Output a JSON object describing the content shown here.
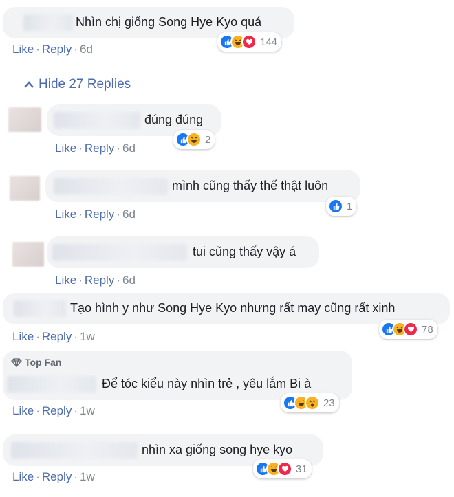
{
  "comments": [
    {
      "text": "Nhìn chị giống Song Hye Kyo quá",
      "like": "Like",
      "reply": "Reply",
      "time": "6d",
      "reaction_count": "144",
      "reactions": [
        "like-icon",
        "haha-icon",
        "love-icon"
      ]
    },
    {
      "text": "đúng đúng",
      "like": "Like",
      "reply": "Reply",
      "time": "6d",
      "reaction_count": "2",
      "reactions": [
        "like-icon",
        "haha-icon"
      ]
    },
    {
      "text": "mình cũng thấy thế thật luôn",
      "like": "Like",
      "reply": "Reply",
      "time": "6d",
      "reaction_count": "1",
      "reactions": [
        "like-icon"
      ]
    },
    {
      "text": "tui cũng thấy vậy á",
      "like": "Like",
      "reply": "Reply",
      "time": "6d"
    },
    {
      "text": "Tạo hình y như Song Hye Kyo nhưng rất may cũng rất xinh",
      "like": "Like",
      "reply": "Reply",
      "time": "1w",
      "reaction_count": "78",
      "reactions": [
        "like-icon",
        "haha-icon",
        "love-icon"
      ]
    },
    {
      "badge": "Top Fan",
      "text": "Để tóc kiểu này nhìn trẻ , yêu lắm Bi à",
      "like": "Like",
      "reply": "Reply",
      "time": "1w",
      "reaction_count": "23",
      "reactions": [
        "like-icon",
        "haha-icon",
        "wow-icon"
      ]
    },
    {
      "text": "nhìn xa giống song hye kyo",
      "like": "Like",
      "reply": "Reply",
      "time": "1w",
      "reaction_count": "31",
      "reactions": [
        "like-icon",
        "haha-icon",
        "love-icon"
      ]
    }
  ],
  "hide_replies": "Hide 27 Replies",
  "separator": "·",
  "colors": {
    "link": "#4b6cae",
    "bubble": "#f2f3f5",
    "like": "#1877f2",
    "haha": "#f7b125",
    "love": "#f0284a"
  }
}
